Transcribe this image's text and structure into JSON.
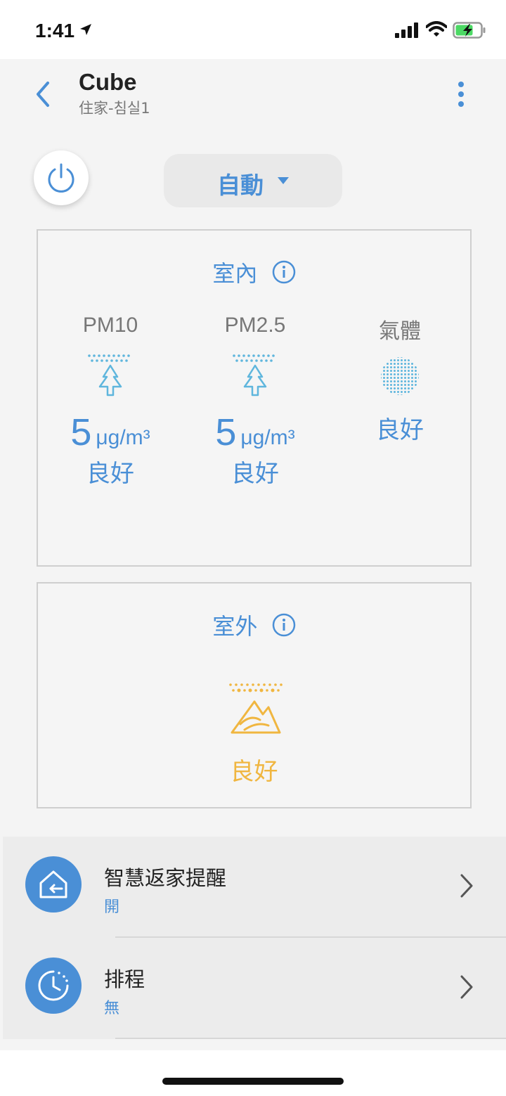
{
  "status_bar": {
    "time": "1:41"
  },
  "header": {
    "title": "Cube",
    "subtitle": "住家-침실1"
  },
  "controls": {
    "mode_label": "自動"
  },
  "indoor": {
    "title": "室內",
    "metrics": [
      {
        "label": "PM10",
        "value": "5",
        "unit": "μg/m³",
        "status": "良好"
      },
      {
        "label": "PM2.5",
        "value": "5",
        "unit": "μg/m³",
        "status": "良好"
      },
      {
        "label": "氣體",
        "status": "良好"
      }
    ]
  },
  "outdoor": {
    "title": "室外",
    "status": "良好"
  },
  "list": [
    {
      "title": "智慧返家提醒",
      "value": "開"
    },
    {
      "title": "排程",
      "value": "無"
    }
  ],
  "colors": {
    "accent": "#4a8fd6",
    "outdoor": "#f0b640",
    "indoor_icon": "#5fb6dd"
  }
}
